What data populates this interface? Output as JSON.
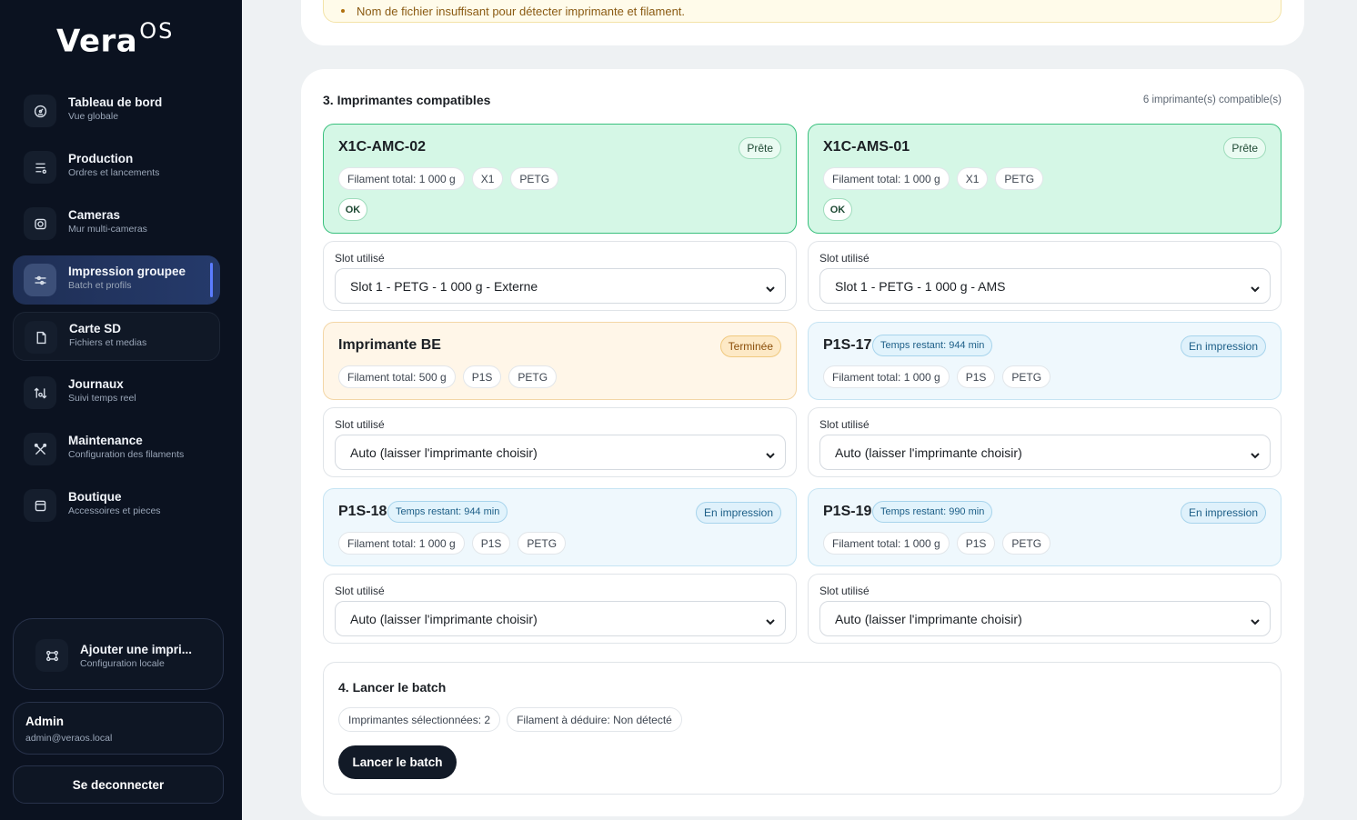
{
  "brand": {
    "name": "Vera",
    "suffix": "OS"
  },
  "nav": [
    {
      "title": "Tableau de bord",
      "sub": "Vue globale",
      "icon": "dashboard-icon"
    },
    {
      "title": "Production",
      "sub": "Ordres et lancements",
      "icon": "list-icon"
    },
    {
      "title": "Cameras",
      "sub": "Mur multi-cameras",
      "icon": "camera-icon"
    },
    {
      "title": "Impression groupee",
      "sub": "Batch et profils",
      "icon": "sliders-icon",
      "active": true
    },
    {
      "title": "Carte SD",
      "sub": "Fichiers et medias",
      "icon": "file-icon"
    },
    {
      "title": "Journaux",
      "sub": "Suivi temps reel",
      "icon": "arrows-icon"
    },
    {
      "title": "Maintenance",
      "sub": "Configuration des filaments",
      "icon": "tools-icon"
    },
    {
      "title": "Boutique",
      "sub": "Accessoires et pieces",
      "icon": "shop-icon"
    }
  ],
  "add_printer": {
    "title": "Ajouter une impri...",
    "sub": "Configuration locale"
  },
  "user": {
    "name": "Admin",
    "email": "admin@veraos.local"
  },
  "logout_label": "Se deconnecter",
  "warning": {
    "text": "Nom de fichier insuffisant pour détecter imprimante et filament."
  },
  "printers_section": {
    "title": "3. Imprimantes compatibles",
    "count": "6 imprimante(s) compatible(s)"
  },
  "printers": [
    {
      "name": "X1C-AMC-02",
      "status": "Prête",
      "state": "ready",
      "filament": "Filament total: 1 000 g",
      "model": "X1",
      "material": "PETG",
      "ok": "OK",
      "slot_label": "Slot utilisé",
      "slot": "Slot 1 - PETG - 1 000 g - Externe"
    },
    {
      "name": "X1C-AMS-01",
      "status": "Prête",
      "state": "ready",
      "filament": "Filament total: 1 000 g",
      "model": "X1",
      "material": "PETG",
      "ok": "OK",
      "slot_label": "Slot utilisé",
      "slot": "Slot 1 - PETG - 1 000 g - AMS"
    },
    {
      "name": "Imprimante BE",
      "status": "Terminée",
      "state": "done",
      "filament": "Filament total: 500 g",
      "model": "P1S",
      "material": "PETG",
      "slot_label": "Slot utilisé",
      "slot": "Auto (laisser l'imprimante choisir)"
    },
    {
      "name": "P1S-17",
      "status": "En impression",
      "state": "printing",
      "time": "Temps restant: 944 min",
      "filament": "Filament total: 1 000 g",
      "model": "P1S",
      "material": "PETG",
      "slot_label": "Slot utilisé",
      "slot": "Auto (laisser l'imprimante choisir)"
    },
    {
      "name": "P1S-18",
      "status": "En impression",
      "state": "printing",
      "time": "Temps restant: 944 min",
      "filament": "Filament total: 1 000 g",
      "model": "P1S",
      "material": "PETG",
      "slot_label": "Slot utilisé",
      "slot": "Auto (laisser l'imprimante choisir)"
    },
    {
      "name": "P1S-19",
      "status": "En impression",
      "state": "printing",
      "time": "Temps restant: 990 min",
      "filament": "Filament total: 1 000 g",
      "model": "P1S",
      "material": "PETG",
      "slot_label": "Slot utilisé",
      "slot": "Auto (laisser l'imprimante choisir)"
    }
  ],
  "batch": {
    "title": "4. Lancer le batch",
    "selected": "Imprimantes sélectionnées: 2",
    "filament": "Filament à déduire: Non détecté",
    "button": "Lancer le batch"
  },
  "colors": {
    "sidebar": "#0b1220",
    "accent": "#5b7cff",
    "ready": "#39c07d",
    "printing": "#1c5e87",
    "done": "#8a4d08"
  }
}
